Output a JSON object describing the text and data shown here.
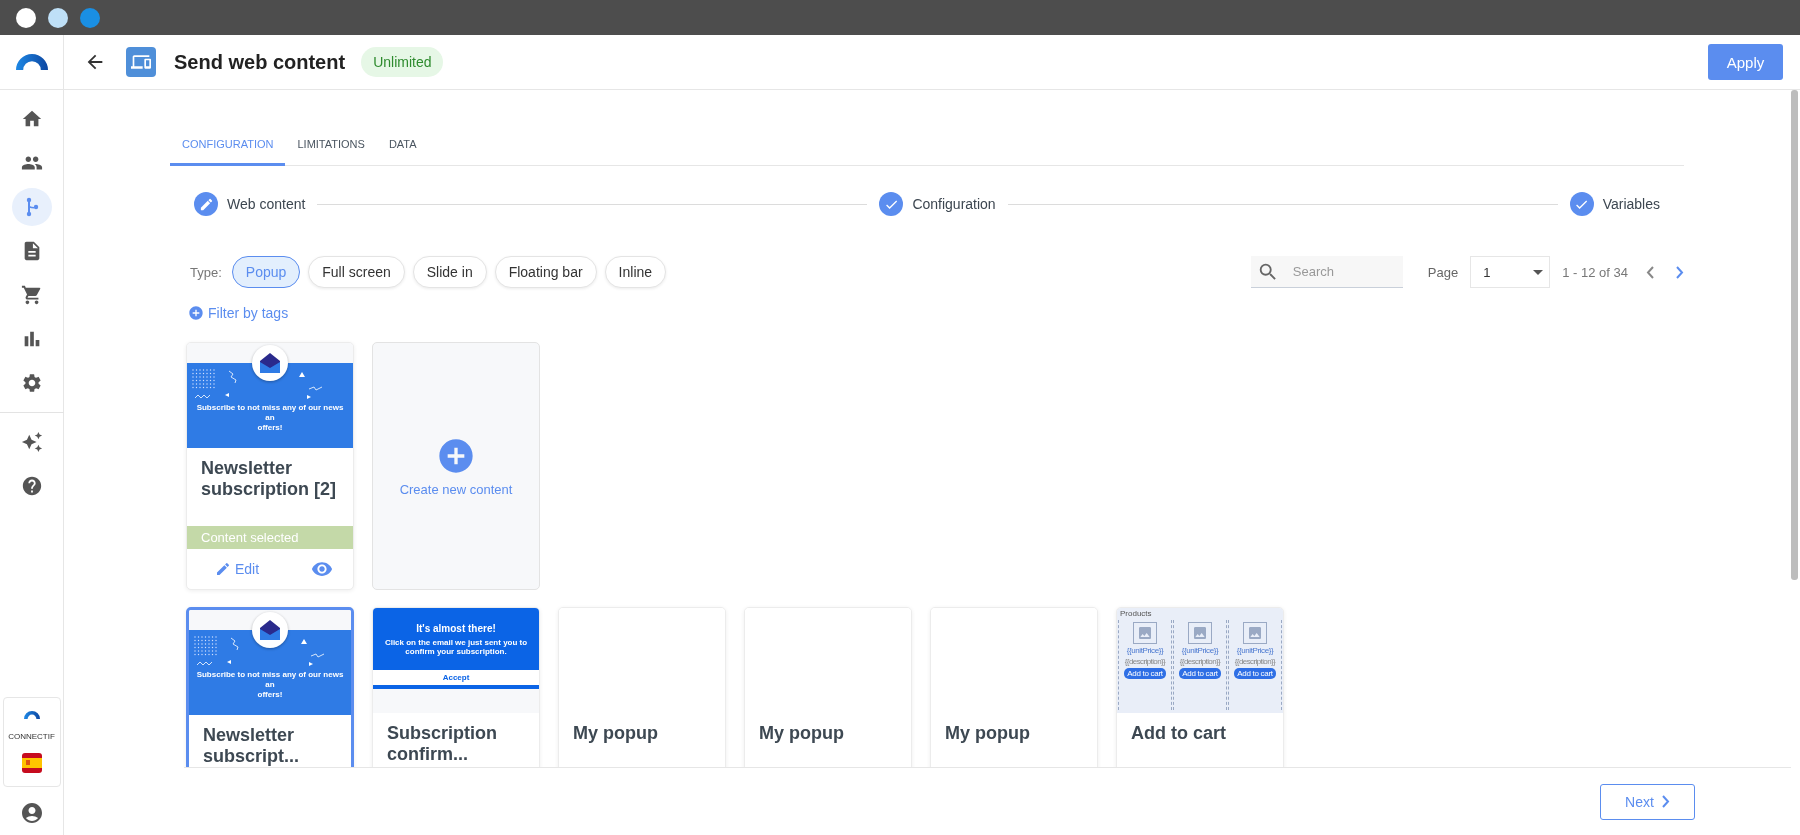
{
  "window": {
    "title": "Send web content",
    "badge": "Unlimited"
  },
  "header_button": "Apply",
  "sidebar": {
    "items": [
      {
        "selected": false
      },
      {
        "selected": false
      },
      {
        "selected": true
      },
      {
        "selected": false
      },
      {
        "selected": false
      },
      {
        "selected": false
      },
      {
        "selected": false
      },
      {
        "selected": false
      },
      {
        "selected": false
      }
    ],
    "logo_text": "CONNECTIF"
  },
  "tabs": [
    {
      "label": "CONFIGURATION",
      "selected": true
    },
    {
      "label": "LIMITATIONS",
      "selected": false
    },
    {
      "label": "DATA",
      "selected": false
    }
  ],
  "steps": [
    {
      "label": "Web content",
      "completed": false
    },
    {
      "label": "Configuration",
      "completed": true
    },
    {
      "label": "Variables",
      "completed": true
    }
  ],
  "type_filter": {
    "label": "Type:",
    "options": [
      {
        "label": "Popup",
        "selected": true
      },
      {
        "label": "Full screen",
        "selected": false
      },
      {
        "label": "Slide in",
        "selected": false
      },
      {
        "label": "Floating bar",
        "selected": false
      },
      {
        "label": "Inline",
        "selected": false
      }
    ]
  },
  "filter_link": "Filter by tags",
  "search": {
    "placeholder": "Search"
  },
  "pagination": {
    "label": "Page",
    "value": "1",
    "range": "1 - 12 of 34",
    "prev_disabled": true,
    "next_disabled": false
  },
  "selected_content": {
    "title": "Newsletter subscription [2]",
    "status": "Content selected",
    "edit": "Edit",
    "preview": {
      "kind": "newsletter",
      "lines": [
        "Subscribe to not miss any of our news an",
        "offers!"
      ]
    }
  },
  "create_card": {
    "label": "Create new content"
  },
  "cards": [
    {
      "title": "Newsletter subscript...",
      "selected": true,
      "preview": {
        "kind": "newsletter",
        "lines": [
          "Subscribe to not miss any of our news an",
          "offers!"
        ]
      }
    },
    {
      "title": "Subscription confirm...",
      "selected": false,
      "preview": {
        "kind": "confirm",
        "heading": "It's almost there!",
        "text": "Click on the email we just sent you to confirm your subscription.",
        "button": "Accept"
      }
    },
    {
      "title": "My popup",
      "selected": false,
      "preview": {
        "kind": "blank"
      }
    },
    {
      "title": "My popup",
      "selected": false,
      "preview": {
        "kind": "blank"
      }
    },
    {
      "title": "My popup",
      "selected": false,
      "preview": {
        "kind": "blank"
      }
    },
    {
      "title": "Add to cart",
      "selected": false,
      "preview": {
        "kind": "products",
        "heading": "Products",
        "items": [
          {
            "price": "{{unitPrice}}",
            "description": "{{description}}",
            "button": "Add to cart"
          },
          {
            "price": "{{unitPrice}}",
            "description": "{{description}}",
            "button": "Add to cart"
          },
          {
            "price": "{{unitPrice}}",
            "description": "{{description}}",
            "button": "Add to cart"
          }
        ]
      }
    }
  ],
  "footer": {
    "next": "Next"
  }
}
